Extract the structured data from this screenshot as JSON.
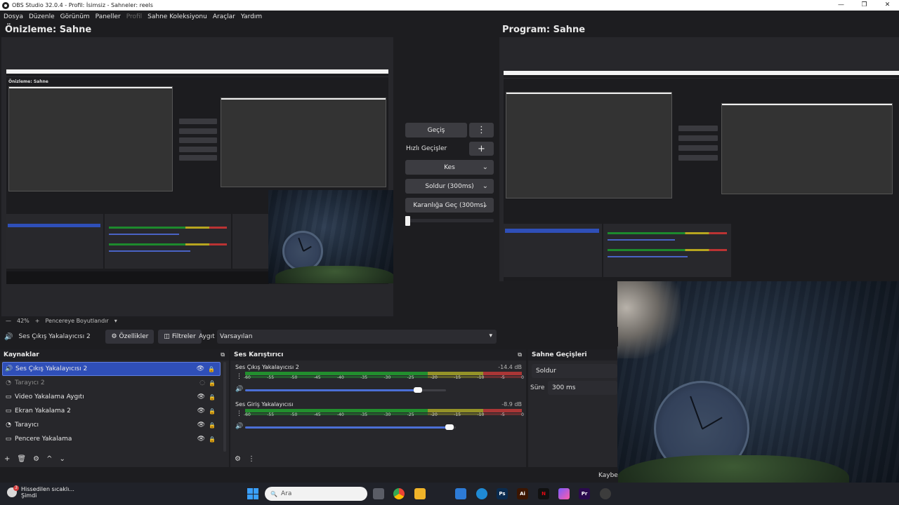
{
  "window": {
    "title": "OBS Studio 32.0.4 - Profil: İsimsiz - Sahneler: reels",
    "controls": {
      "minimize": "—",
      "maximize": "❐",
      "close": "✕"
    }
  },
  "menu": [
    "Dosya",
    "Düzenle",
    "Görünüm",
    "Paneller",
    "Profil",
    "Sahne Koleksiyonu",
    "Araçlar",
    "Yardım"
  ],
  "menu_disabled": "Profil",
  "preview": {
    "title": "Önizleme: Sahne"
  },
  "program": {
    "title": "Program: Sahne"
  },
  "zoom": {
    "minus": "—",
    "value": "42%",
    "plus": "+",
    "fit_label": "Pencereye Boyutlandır",
    "chevron": "▾"
  },
  "transitions": {
    "transition_button": "Geçiş",
    "menu_icon": "⋮",
    "quick_label": "Hızlı Geçişler",
    "add_icon": "+",
    "quick_items": [
      "Kes",
      "Soldur (300ms)",
      "Karanlığa Geç (300ms)"
    ],
    "chevron": "⌄"
  },
  "selected_source": {
    "icon": "🔊",
    "name": "Ses Çıkış Yakalayıcısı 2",
    "properties_icon": "⚙",
    "properties_label": "Özellikler",
    "filters_icon": "◫",
    "filters_label": "Filtreler",
    "preset_label": "Aygıt",
    "preset_value": "Varsayılan",
    "preset_chevron": "▾"
  },
  "sources": {
    "title": "Kaynaklar",
    "float_icon": "⧉",
    "eye_icon": "👁",
    "hidden_icon": "◌",
    "lock_icon": "🔒",
    "items": [
      {
        "icon": "🔊",
        "name": "Ses Çıkış Yakalayıcısı 2"
      },
      {
        "icon": "◔",
        "name": "Tarayıcı 2"
      },
      {
        "icon": "▭",
        "name": "Video Yakalama Aygıtı"
      },
      {
        "icon": "▭",
        "name": "Ekran Yakalama 2"
      },
      {
        "icon": "◔",
        "name": "Tarayıcı"
      },
      {
        "icon": "▭",
        "name": "Pencere Yakalama"
      }
    ],
    "footer_icons": [
      "+",
      "🗑",
      "⚙",
      "^",
      "⌄"
    ]
  },
  "mixer": {
    "title": "Ses Karıştırıcı",
    "float_icon": "⧉",
    "menu_icon": "⋮",
    "volume_icon": "🔊",
    "ticks": [
      "-60",
      "-55",
      "-50",
      "-45",
      "-40",
      "-35",
      "-30",
      "-25",
      "-20",
      "-15",
      "-10",
      "-5",
      "0"
    ],
    "channels": [
      {
        "name": "Ses Çıkış Yakalayıcısı 2",
        "db": "-14.4 dB",
        "volume": 0.86
      },
      {
        "name": "Ses Giriş Yakalayıcısı",
        "db": "-8.9 dB",
        "volume": 0.97
      }
    ],
    "footer_icons": [
      "⚙",
      "⋮"
    ]
  },
  "scene_transitions": {
    "title": "Sahne Geçişleri",
    "selected": "Soldur",
    "duration_label": "Süre",
    "duration_value": "300 ms"
  },
  "status": {
    "text": "Kaybe"
  },
  "taskbar": {
    "weather_badge": "3",
    "weather_line1": "Hissedilen sıcaklı...",
    "weather_line2": "Şimdi",
    "search_placeholder": "Ara",
    "search_icon": "🔍",
    "apps": [
      "Ps",
      "Ai",
      "N",
      "Pr"
    ],
    "colors": {
      "ps": "#0a2b4e",
      "ai": "#3b1500",
      "netflix": "#e50914",
      "pr": "#2a0a4d",
      "edge": "#1f8ad4",
      "chrome": "#34a853",
      "folder": "#f0b429",
      "mail": "#2d7bd6"
    }
  },
  "accent": {
    "selection": "#2f4fb8",
    "meter_green": "#21a12f",
    "meter_yellow": "#a8a628",
    "meter_red": "#c13838"
  }
}
